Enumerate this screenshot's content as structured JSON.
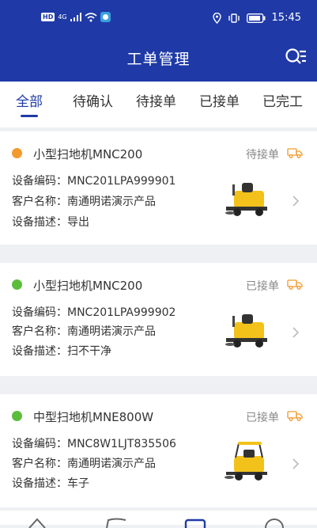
{
  "status_bar": {
    "time": "15:45",
    "network": "4G",
    "hd": "HD"
  },
  "header": {
    "title": "工单管理"
  },
  "tabs": [
    {
      "label": "全部",
      "active": true
    },
    {
      "label": "待确认",
      "active": false
    },
    {
      "label": "待接单",
      "active": false
    },
    {
      "label": "已接单",
      "active": false
    },
    {
      "label": "已完工",
      "active": false
    }
  ],
  "labels": {
    "code": "设备编码：",
    "customer": "客户名称：",
    "desc": "设备描述："
  },
  "orders": [
    {
      "name": "小型扫地机MNC200",
      "status": "待接单",
      "status_color": "#f29a2e",
      "code": "MNC201LPA999901",
      "customer": "南通明诺演示产品",
      "desc": "导出"
    },
    {
      "name": "小型扫地机MNC200",
      "status": "已接单",
      "status_color": "#5cbd3c",
      "code": "MNC201LPA999902",
      "customer": "南通明诺演示产品",
      "desc": "扫不干净"
    },
    {
      "name": "中型扫地机MNE800W",
      "status": "已接单",
      "status_color": "#5cbd3c",
      "code": "MNC8W1LJT835506",
      "customer": "南通明诺演示产品",
      "desc": "车子"
    }
  ],
  "colors": {
    "primary": "#1f3aa7",
    "pending": "#f29a2e",
    "accepted": "#5cbd3c"
  }
}
